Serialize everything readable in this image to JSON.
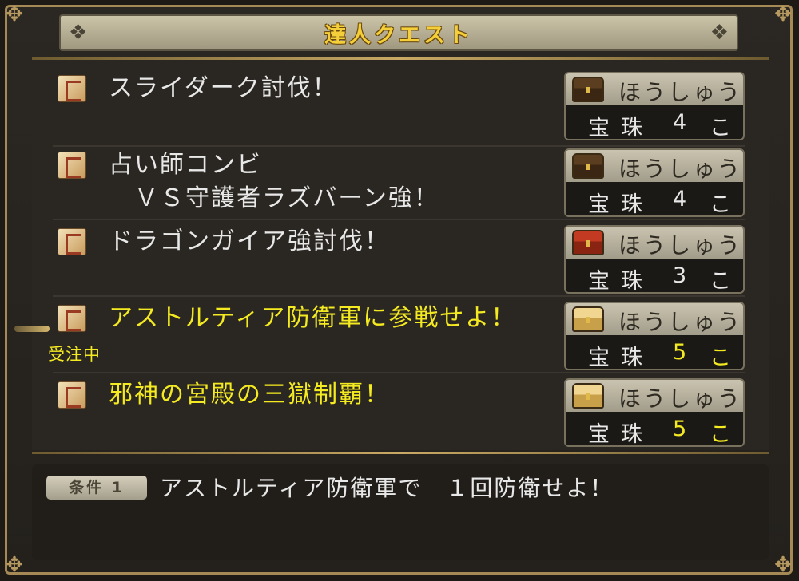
{
  "window": {
    "title": "達人クエスト"
  },
  "quests": [
    {
      "name": "スライダーク討伐！",
      "yellow": false,
      "reward_label": "ほうしゅう",
      "chest": "brown",
      "item": "宝珠",
      "count": "4",
      "unit": "こ"
    },
    {
      "name": "占い師コンビ\n　ＶＳ守護者ラズバーン強！",
      "yellow": false,
      "reward_label": "ほうしゅう",
      "chest": "brown",
      "item": "宝珠",
      "count": "4",
      "unit": "こ"
    },
    {
      "name": "ドラゴンガイア強討伐！",
      "yellow": false,
      "reward_label": "ほうしゅう",
      "chest": "red",
      "item": "宝珠",
      "count": "3",
      "unit": "こ"
    },
    {
      "name": "アストルティア防衛軍に参戦せよ！",
      "yellow": true,
      "reward_label": "ほうしゅう",
      "chest": "gold",
      "item": "宝珠",
      "count": "5",
      "unit": "こ"
    },
    {
      "name": "邪神の宮殿の三獄制覇！",
      "yellow": true,
      "reward_label": "ほうしゅう",
      "chest": "gold",
      "item": "宝珠",
      "count": "5",
      "unit": "こ"
    }
  ],
  "accepted_label": "受注中",
  "condition": {
    "badge": "条件 1",
    "text": "アストルティア防衛軍で　１回防衛せよ！"
  },
  "colors": {
    "title": "#f4cf3a",
    "highlight": "#f4ea21",
    "frame": "#a58a55"
  }
}
